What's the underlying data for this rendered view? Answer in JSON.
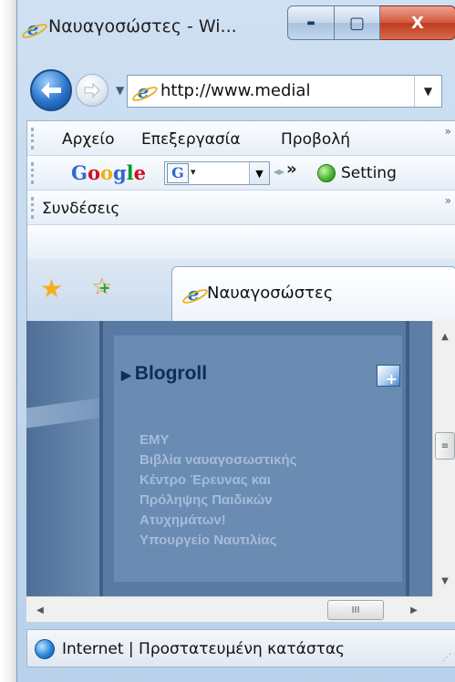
{
  "window": {
    "title": "Ναυαγοσώστες - Wi...",
    "caption": {
      "minimize": "▬",
      "maximize": "▢",
      "close": "X"
    }
  },
  "address": {
    "url": "http://www.medial",
    "dropdown": "▼",
    "nav_dropdown": "▼"
  },
  "menu": {
    "items": [
      "Αρχείο",
      "Επεξεργασία",
      "Προβολή"
    ],
    "more": "»"
  },
  "google_toolbar": {
    "logo": "Google",
    "search_logo": "G",
    "search_drop": "▾",
    "dropdown": "▼",
    "separator": "◂▸",
    "more": "»",
    "settings_label": "Setting"
  },
  "links_bar": {
    "label": "Συνδέσεις",
    "more": "»"
  },
  "tabs": [
    {
      "label": "Ναυαγοσώστες"
    }
  ],
  "page": {
    "blogroll": {
      "arrow": "▶",
      "title": "Blogroll",
      "links": [
        "ΕΜΥ",
        "Βιβλία ναυαγοσωστικής",
        "Κέντρο Έρευνας και",
        "Πρόληψης Παιδικών",
        "Ατυχημάτων!",
        "Υπουργείο Ναυτιλίας"
      ]
    }
  },
  "scrollbars": {
    "up": "▲",
    "down": "▼",
    "left": "◀",
    "right": "▶",
    "thumb_grip": "≡",
    "h_thumb_grip": "III"
  },
  "status": {
    "text": "Internet | Προστατευμένη κατάστας",
    "grip": "⋰"
  },
  "colors": {
    "accent": "#1a6fd2",
    "page_bg": "#5e7ea6",
    "blogroll_title": "#0e2d57",
    "blogroll_links": "#a3bcd9"
  },
  "icons": [
    "ie-icon",
    "back-arrow-icon",
    "forward-arrow-icon",
    "star-icon",
    "add-favorite-icon",
    "globe-icon",
    "settings-icon",
    "blog-add-icon"
  ]
}
